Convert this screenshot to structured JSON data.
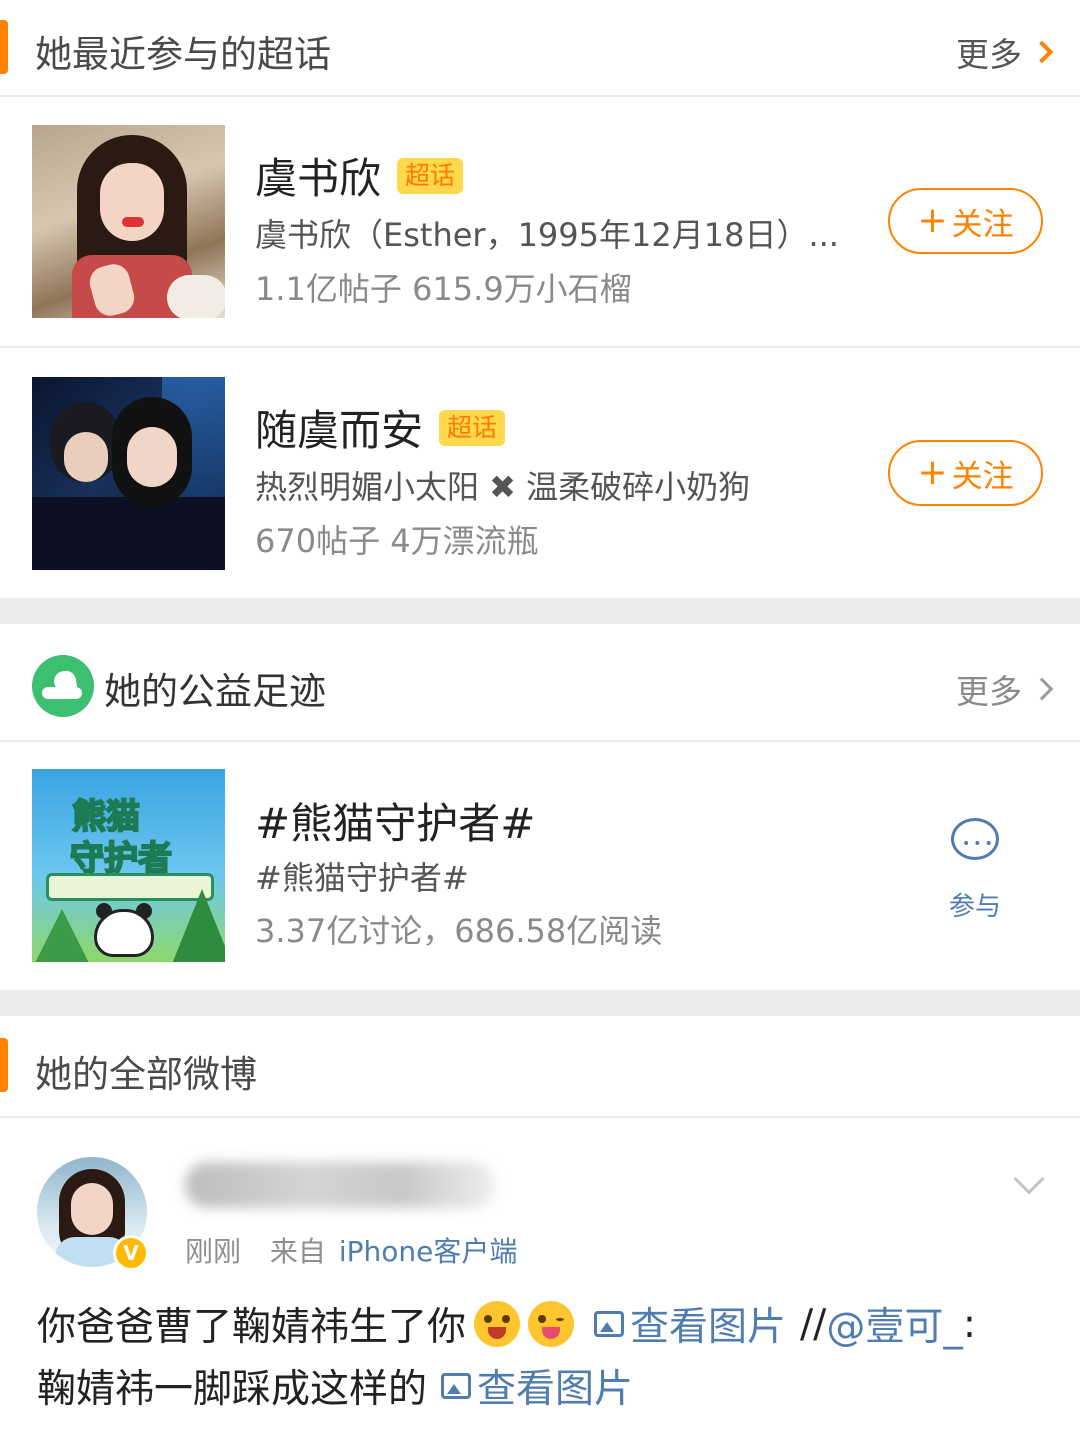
{
  "super_topics": {
    "title": "她最近参与的超话",
    "more_label": "更多",
    "items": [
      {
        "name": "虞书欣",
        "badge": "超话",
        "description": "虞书欣（Esther，1995年12月18日）...",
        "stats": "1.1亿帖子 615.9万小石榴",
        "follow_label": "关注",
        "follow_plus": "+"
      },
      {
        "name": "随虞而安",
        "badge": "超话",
        "description": "热烈明媚小太阳 ✖ 温柔破碎小奶狗",
        "stats": "670帖子 4万漂流瓶",
        "follow_label": "关注",
        "follow_plus": "+"
      }
    ]
  },
  "charity": {
    "title": "她的公益足迹",
    "more_label": "更多",
    "item": {
      "name": "#熊猫守护者#",
      "subtitle": "#熊猫守护者#",
      "stats": "3.37亿讨论，686.58亿阅读",
      "join_label": "参与",
      "thumb_line1": "熊猫",
      "thumb_line2": "守护者"
    }
  },
  "weibo": {
    "title": "她的全部微博",
    "post": {
      "verified_mark": "V",
      "time": "刚刚",
      "from_label": "来自",
      "source": "iPhone客户端",
      "line1_text": "你爸爸曹了鞠婧祎生了你",
      "view_image_label": "查看图片",
      "repost_prefix": "//",
      "mention": "@壹可_",
      "colon": ":",
      "line2_text": "鞠婧祎一脚踩成这样的"
    }
  },
  "colors": {
    "accent": "#ff8200",
    "link": "#507daf",
    "charity_green": "#3cbf70",
    "badge_yellow": "#ffd84d"
  }
}
